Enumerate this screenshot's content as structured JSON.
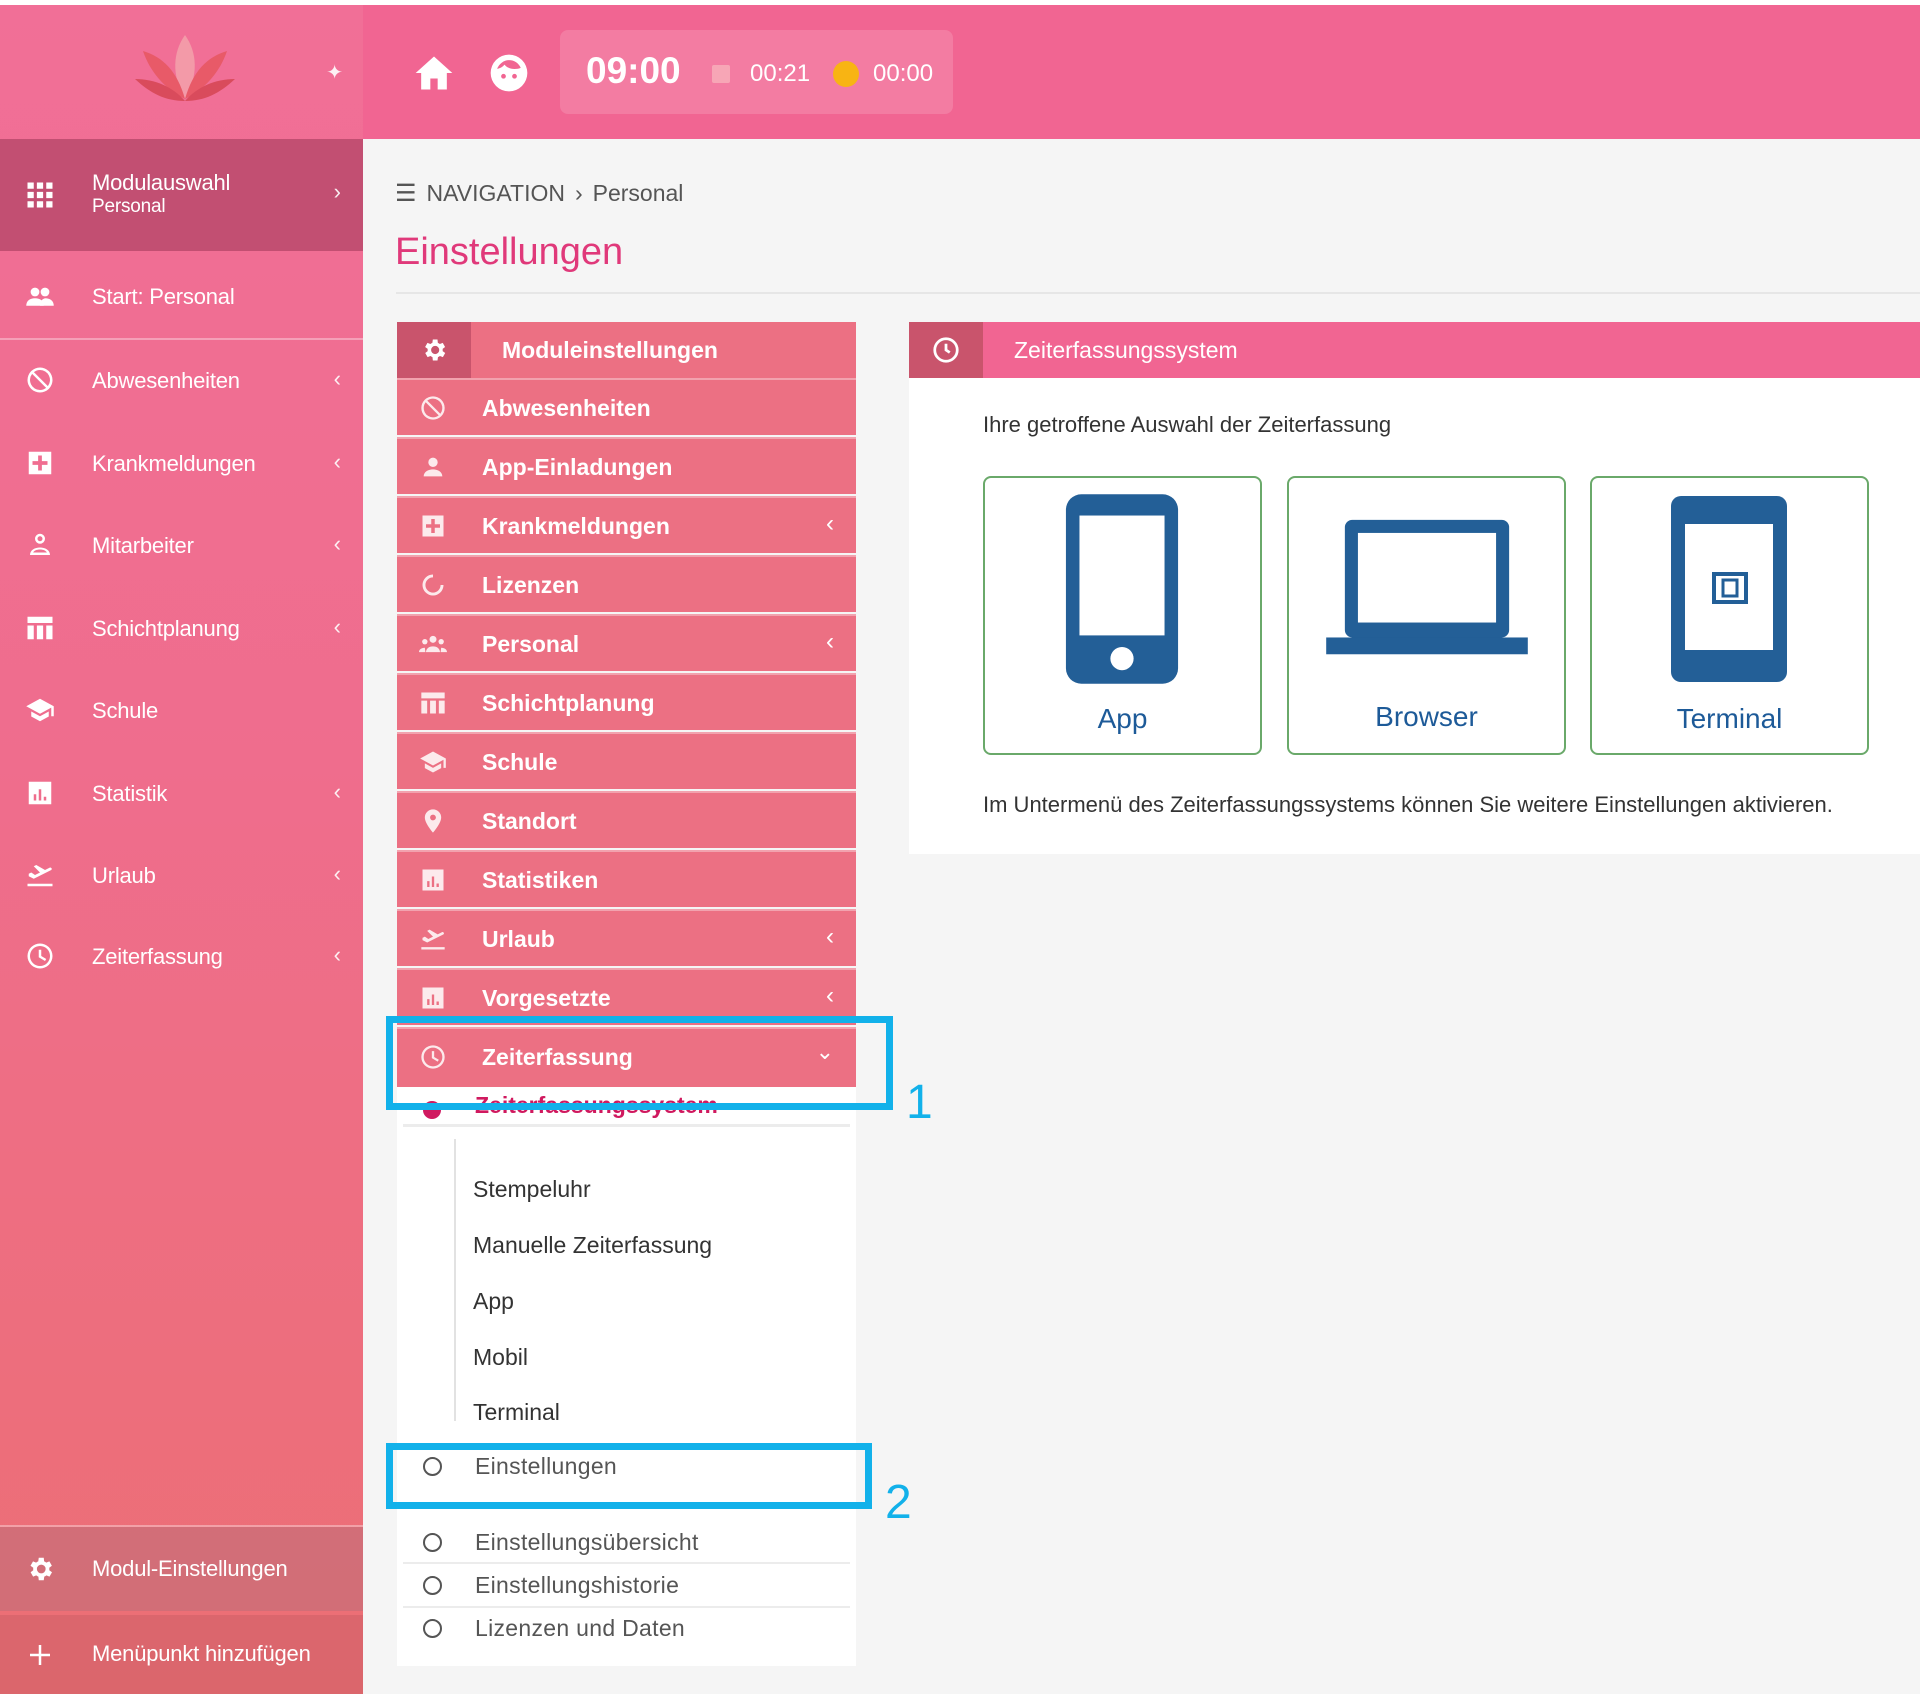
{
  "sidebar": {
    "module_select": {
      "title": "Modulauswahl",
      "subtitle": "Personal"
    },
    "items": [
      {
        "label": "Start: Personal"
      },
      {
        "label": "Abwesenheiten"
      },
      {
        "label": "Krankmeldungen"
      },
      {
        "label": "Mitarbeiter"
      },
      {
        "label": "Schichtplanung"
      },
      {
        "label": "Schule"
      },
      {
        "label": "Statistik"
      },
      {
        "label": "Urlaub"
      },
      {
        "label": "Zeiterfassung"
      }
    ],
    "footer": [
      {
        "label": "Modul-Einstellungen"
      },
      {
        "label": "Menüpunkt hinzufügen"
      }
    ]
  },
  "topbar": {
    "clock": "09:00",
    "work_time": "00:21",
    "break_time": "00:00"
  },
  "breadcrumb": {
    "root": "NAVIGATION",
    "current": "Personal"
  },
  "page_title": "Einstellungen",
  "settings_menu": {
    "header": "Moduleinstellungen",
    "items": [
      {
        "label": "Abwesenheiten"
      },
      {
        "label": "App-Einladungen"
      },
      {
        "label": "Krankmeldungen"
      },
      {
        "label": "Lizenzen"
      },
      {
        "label": "Personal"
      },
      {
        "label": "Schichtplanung"
      },
      {
        "label": "Schule"
      },
      {
        "label": "Standort"
      },
      {
        "label": "Statistiken"
      },
      {
        "label": "Urlaub"
      },
      {
        "label": "Vorgesetzte"
      },
      {
        "label": "Zeiterfassung"
      }
    ],
    "sub_active": "Zeiterfassungssystem",
    "sub_tree": [
      "Stempeluhr",
      "Manuelle Zeiterfassung",
      "App",
      "Mobil",
      "Terminal"
    ],
    "radio_items": [
      "Einstellungen",
      "Einstellungsübersicht",
      "Einstellungshistorie",
      "Lizenzen und Daten"
    ]
  },
  "card": {
    "header": "Zeiterfassungssystem",
    "intro": "Ihre getroffene Auswahl der Zeiterfassung",
    "options": [
      {
        "label": "App",
        "icon": "smartphone-icon"
      },
      {
        "label": "Browser",
        "icon": "laptop-icon"
      },
      {
        "label": "Terminal",
        "icon": "terminal-icon"
      }
    ],
    "note": "Im Untermenü des Zeiterfassungssystems können Sie weitere Einstellungen aktivieren."
  },
  "callouts": [
    "1",
    "2"
  ],
  "colors": {
    "brand_pink": "#f16592",
    "menu_pink": "#ec7083",
    "accent_magenta": "#d0195f",
    "option_border": "#6aa96a",
    "option_icon": "#235f97",
    "callout": "#12b1ea"
  }
}
